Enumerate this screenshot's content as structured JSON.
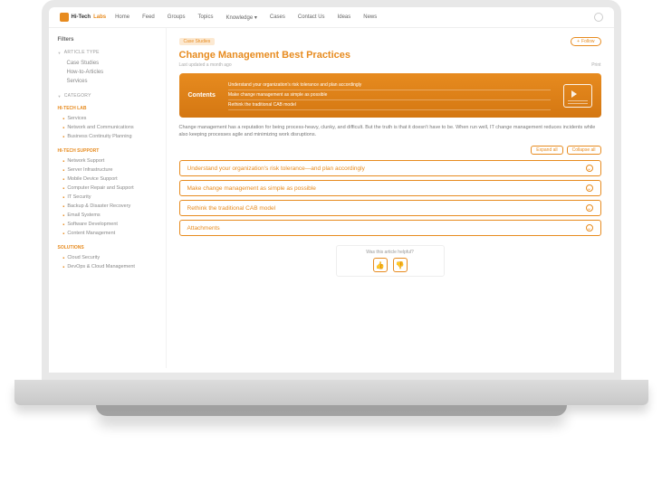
{
  "logo": {
    "brand": "Hi-Tech",
    "accent": "Labs"
  },
  "nav": [
    "Home",
    "Feed",
    "Groups",
    "Topics",
    "Knowledge ▾",
    "Cases",
    "Contact Us",
    "Ideas",
    "News"
  ],
  "sidebar": {
    "title": "Filters",
    "articleType": {
      "head": "ARTICLE TYPE",
      "items": [
        "Case Studies",
        "How-to-Articles",
        "Services"
      ]
    },
    "categoryHead": "CATEGORY",
    "groups": [
      {
        "name": "HI-TECH LAB",
        "items": [
          "Services",
          "Network and Communications",
          "Business Continuity Planning"
        ]
      },
      {
        "name": "HI-TECH SUPPORT",
        "items": [
          "Network Support",
          "Server Infrastructure",
          "Mobile Device Support",
          "Computer Repair and Support",
          "IT Security",
          "Backup & Disaster Recovery",
          "Email Systems",
          "Software Development",
          "Content Management"
        ]
      },
      {
        "name": "SOLUTIONS",
        "items": [
          "Cloud Security",
          "DevOps & Cloud Management"
        ]
      }
    ]
  },
  "main": {
    "crumb": "Case Studies",
    "follow": "Follow",
    "title": "Change Management Best Practices",
    "updated": "Last updated a month ago",
    "views": "Print",
    "contentsLabel": "Contents",
    "contentsItems": [
      "Understand your organization's risk tolerance and plan accordingly",
      "Make change management as simple as possible",
      "Rethink the traditional CAB model"
    ],
    "desc": "Change management has a reputation for being process-heavy, clunky, and difficult. But the truth is that it doesn't have to be. When run well, IT change management reduces incidents while also keeping processes agile and minimizing work disruptions.",
    "expand": "Expand all",
    "collapse": "Collapse all",
    "sections": [
      "Understand your organization's risk tolerance—and plan accordingly",
      "Make change management as simple as possible",
      "Rethink the traditional CAB model",
      "Attachments"
    ],
    "helpful": "Was this article helpful?"
  }
}
